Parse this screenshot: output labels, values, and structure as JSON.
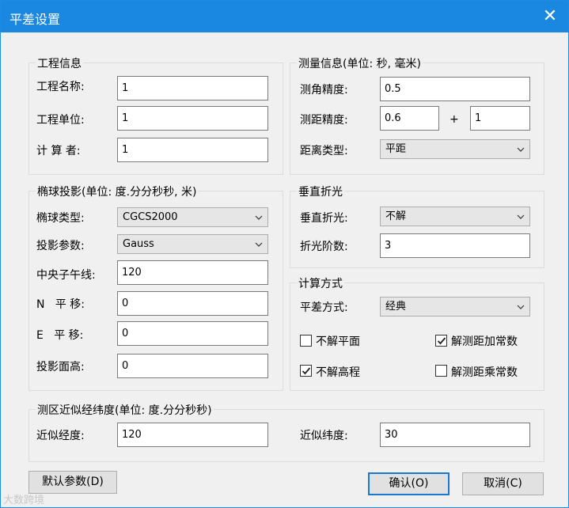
{
  "window": {
    "title": "平差设置",
    "close_glyph": "✕"
  },
  "project": {
    "legend": "工程信息",
    "name_label": "工程名称:",
    "name_value": "1",
    "unit_label": "工程单位:",
    "unit_value": "1",
    "calc_label": "计 算 者:",
    "calc_value": "1"
  },
  "measure": {
    "legend": "测量信息(单位: 秒, 毫米)",
    "angle_label": "测角精度:",
    "angle_value": "0.5",
    "dist_label": "测距精度:",
    "dist_value_a": "0.6",
    "plus": "+",
    "dist_value_b": "1",
    "type_label": "距离类型:",
    "type_value": "平距"
  },
  "ellipsoid": {
    "legend": "椭球投影(单位: 度.分分秒秒, 米)",
    "type_label": "椭球类型:",
    "type_value": "CGCS2000",
    "proj_label": "投影参数:",
    "proj_value": "Gauss",
    "meridian_label": "中央子午线:",
    "meridian_value": "120",
    "n_label": "N   平 移:",
    "n_value": "0",
    "e_label": "E   平 移:",
    "e_value": "0",
    "height_label": "投影面高:",
    "height_value": "0"
  },
  "refraction": {
    "legend": "垂直折光",
    "vert_label": "垂直折光:",
    "vert_value": "不解",
    "order_label": "折光阶数:",
    "order_value": "3"
  },
  "calc": {
    "legend": "计算方式",
    "method_label": "平差方式:",
    "method_value": "经典",
    "opt1_label": "不解平面",
    "opt1_checked": false,
    "opt2_label": "解测距加常数",
    "opt2_checked": true,
    "opt3_label": "不解高程",
    "opt3_checked": true,
    "opt4_label": "解测距乘常数",
    "opt4_checked": false
  },
  "latlon": {
    "legend": "测区近似经纬度(单位: 度.分分秒秒)",
    "lon_label": "近似经度:",
    "lon_value": "120",
    "lat_label": "近似纬度:",
    "lat_value": "30"
  },
  "buttons": {
    "default": "默认参数(D)",
    "ok": "确认(O)",
    "cancel": "取消(C)"
  },
  "watermark": "大数跨境"
}
